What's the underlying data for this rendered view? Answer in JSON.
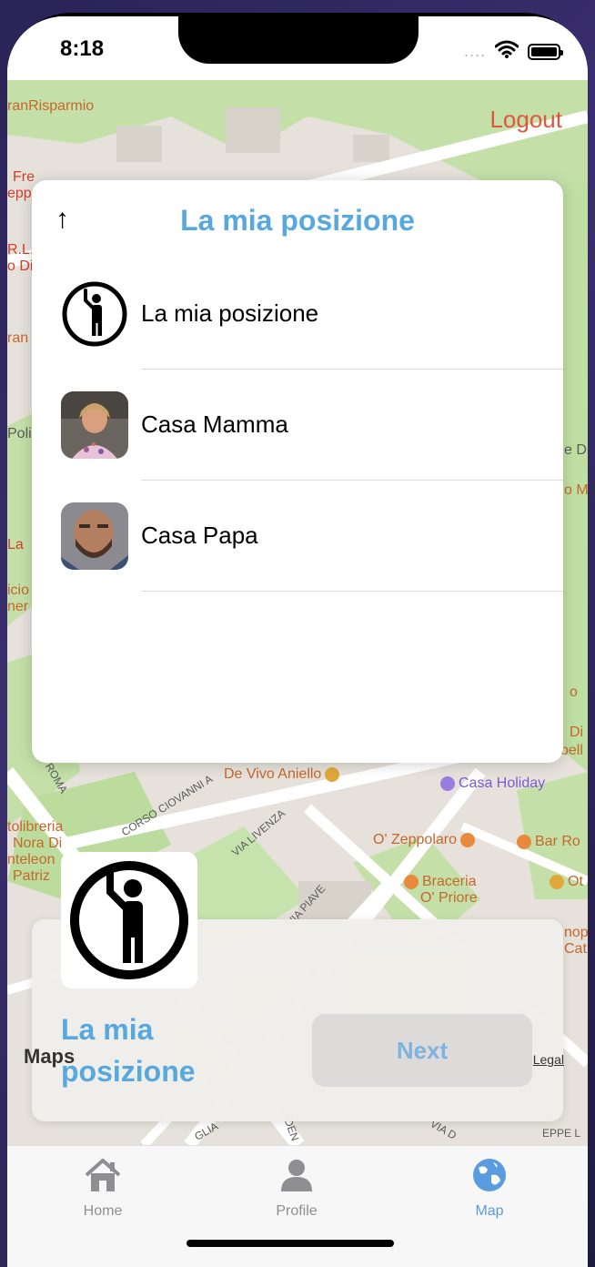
{
  "status_bar": {
    "time": "8:18",
    "signal_dots": "....",
    "wifi_icon": "wifi-icon",
    "battery_icon": "battery-icon"
  },
  "header": {
    "logout_label": "Logout"
  },
  "map": {
    "labels": [
      "ranRisparmio",
      "Fre",
      "epp",
      "R.L.",
      "o Di",
      "ran",
      "Poli",
      "La",
      "icio",
      "ner",
      "e Di",
      "o M",
      "o",
      "Di",
      "bell",
      "De Vivo Aniello",
      "Casa Holiday",
      "O' Zeppolaro",
      "Bar Ro",
      "Braceria",
      "O' Priore",
      "Ot",
      "nop",
      "Cat",
      "tolibreria",
      "Nora Di",
      "nteleon",
      "Patriz",
      "ROMA",
      "CORSO CIOVANNI A",
      "VIA LIVENZA",
      "VIA PIAVE",
      "GLIA",
      "DEN",
      "VIA D",
      "EPPE L"
    ],
    "maps_logo": "Maps",
    "legal": "Legal"
  },
  "sheet": {
    "back_icon": "arrow-up-icon",
    "title": "La mia posizione",
    "items": [
      {
        "label": "La mia posizione",
        "icon": "person-waving-icon"
      },
      {
        "label": "Casa Mamma",
        "icon": "mamma-avatar"
      },
      {
        "label": "Casa Papa",
        "icon": "papa-avatar"
      }
    ]
  },
  "card": {
    "name": "La mia posizione",
    "next_label": "Next",
    "icon": "person-waving-icon"
  },
  "tabs": [
    {
      "label": "Home",
      "icon": "house-icon",
      "active": false
    },
    {
      "label": "Profile",
      "icon": "person-icon",
      "active": false
    },
    {
      "label": "Map",
      "icon": "globe-icon",
      "active": true
    }
  ],
  "colors": {
    "accent": "#58a8e0",
    "logout": "#e0573f",
    "tab_active": "#5b9be0",
    "tab_inactive": "#8e8e93"
  }
}
